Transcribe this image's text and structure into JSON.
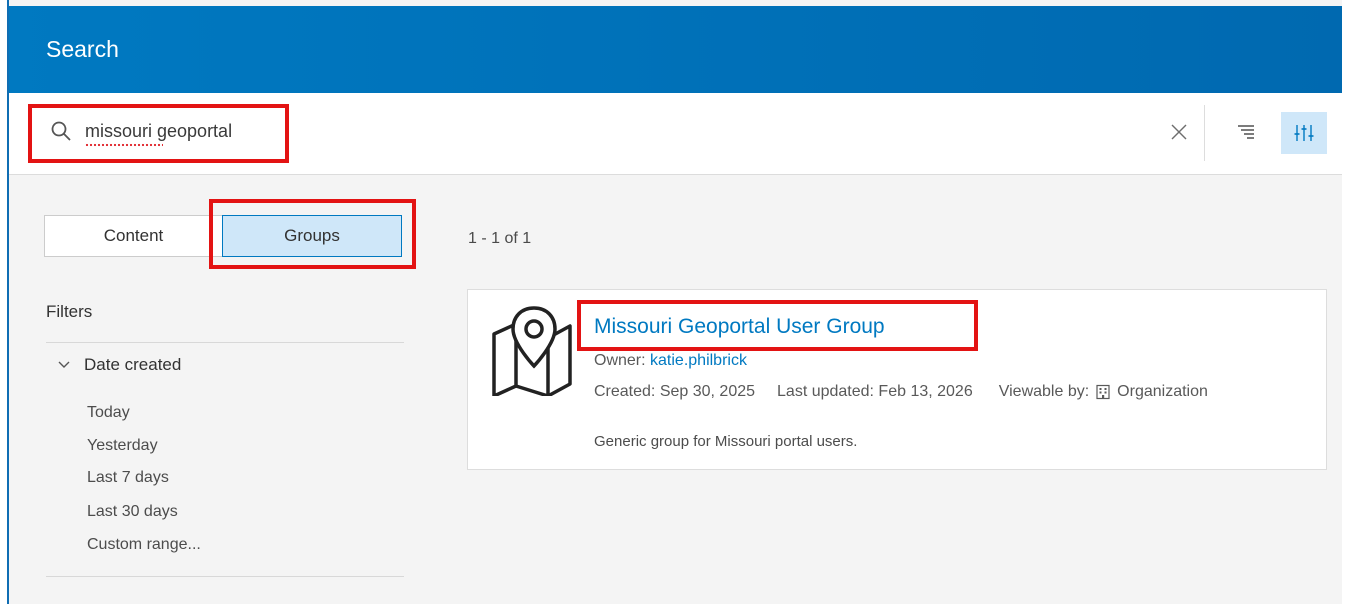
{
  "header": {
    "title": "Search"
  },
  "search": {
    "query": "missouri geoportal"
  },
  "tabs": [
    {
      "label": "Content",
      "selected": false
    },
    {
      "label": "Groups",
      "selected": true
    }
  ],
  "filters": {
    "title": "Filters",
    "date_created": {
      "label": "Date created",
      "expanded": true,
      "options": [
        "Today",
        "Yesterday",
        "Last 7 days",
        "Last 30 days",
        "Custom range..."
      ]
    }
  },
  "results": {
    "count_text": "1 - 1 of 1",
    "items": [
      {
        "title": "Missouri Geoportal User Group",
        "owner_label": "Owner:",
        "owner": "katie.philbrick",
        "created": "Created: Sep 30, 2025",
        "updated": "Last updated: Feb 13, 2026",
        "viewable_label": "Viewable by:",
        "viewable_value": "Organization",
        "description": "Generic group for Missouri portal users."
      }
    ]
  },
  "colors": {
    "header_bg": "#0079c1",
    "accent": "#0079c1",
    "selected_bg": "#cfe7f9",
    "highlight": "#e31313"
  },
  "icons": {
    "search": "search-icon",
    "clear": "close-icon",
    "sort": "sort-icon",
    "filter_toggle": "sliders-icon",
    "date_toggle": "chevron-down-icon",
    "thumbnail": "map-pin-icon",
    "viewable": "building-icon"
  }
}
